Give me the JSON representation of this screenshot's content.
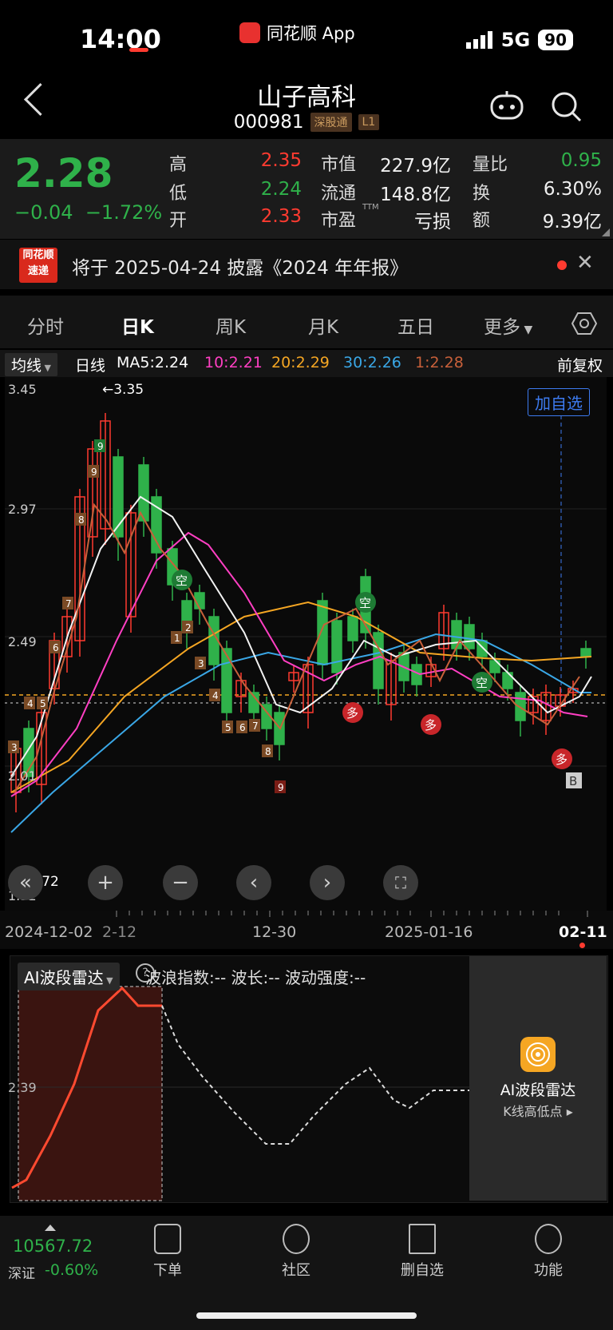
{
  "status_bar": {
    "time": "14:00",
    "app_name": "同花顺 App",
    "network": "5G",
    "battery": "90"
  },
  "nav": {
    "title": "山子高科",
    "code": "000981",
    "tag1": "深股通",
    "tag2": "L1"
  },
  "quote": {
    "price": "2.28",
    "change": "−0.04",
    "change_pct": "−1.72%",
    "high_label": "高",
    "high": "2.35",
    "low_label": "低",
    "low": "2.24",
    "open_label": "开",
    "open": "2.33",
    "mktcap_label": "市值",
    "mktcap": "227.9亿",
    "float_label": "流通",
    "float": "148.8亿",
    "pe_label": "市盈",
    "pe_sup": "TTM",
    "pe": "亏损",
    "vr_label": "量比",
    "vr": "0.95",
    "turnover_label": "换",
    "turnover": "6.30%",
    "amount_label": "额",
    "amount": "9.39亿"
  },
  "notice": {
    "logo_line1": "同花顺",
    "logo_line2": "速递",
    "text": "将于 2025-04-24 披露《2024 年年报》"
  },
  "tabs": [
    "分时",
    "日K",
    "周K",
    "月K",
    "五日",
    "更多",
    ""
  ],
  "ma_row": {
    "dropdown": "均线",
    "period": "日线",
    "ma5": "MA5:2.24",
    "ma10": "10:2.21",
    "ma20": "20:2.29",
    "ma30": "30:2.26",
    "ma1": "1:2.28",
    "adjust": "前复权"
  },
  "chart": {
    "price_labels": [
      "3.45",
      "2.97",
      "2.49",
      "2.01",
      "1.52"
    ],
    "high_marker": "←3.35",
    "low_marker": "1.72",
    "add_fav": "加自选",
    "colors": {
      "up": "#ff3b30",
      "down": "#2fb14a",
      "ma5": "#ffffff",
      "ma10": "#ff3fc3",
      "ma20": "#f5a623",
      "ma30": "#3aa7e6"
    }
  },
  "dates": {
    "d1": "2024-12-02",
    "d2": "2-12",
    "d3": "12-30",
    "d4": "2025-01-16",
    "d5": "02-11"
  },
  "ai": {
    "title": "AI波段雷达",
    "stats": "波浪指数:--  波长:--  波动强度:--",
    "level": "2.39",
    "card_title": "AI波段雷达",
    "card_sub": "K线高低点 ▸"
  },
  "bottom": {
    "index_value": "10567.72",
    "index_name": "深证",
    "index_chg": "-0.60%",
    "items": [
      "下单",
      "社区",
      "删自选",
      "功能"
    ]
  }
}
